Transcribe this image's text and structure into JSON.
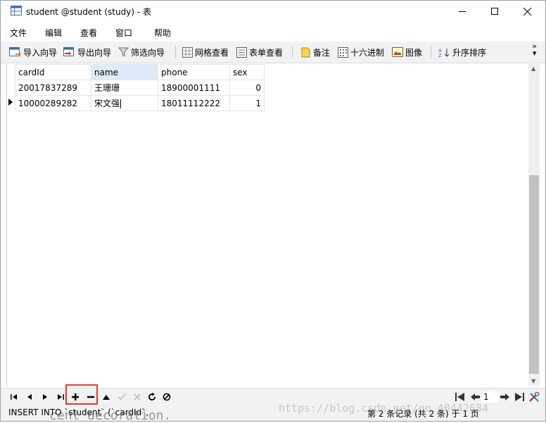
{
  "window": {
    "title": "student @student (study) - 表"
  },
  "menu": [
    "文件",
    "编辑",
    "查看",
    "窗口",
    "帮助"
  ],
  "toolbar": {
    "import_wizard": "导入向导",
    "export_wizard": "导出向导",
    "filter_wizard": "筛选向导",
    "grid_view": "网格查看",
    "form_view": "表单查看",
    "memo": "备注",
    "hex": "十六进制",
    "image": "图像",
    "sort_asc": "升序排序",
    "overflow": "»"
  },
  "grid": {
    "columns": [
      "cardId",
      "name",
      "phone",
      "sex"
    ],
    "selected_column": "name",
    "rows": [
      {
        "cardId": "20017837289",
        "name": "王珊珊",
        "phone": "18900001111",
        "sex": "0"
      },
      {
        "cardId": "10000289282",
        "name": "宋文强",
        "phone": "18011112222",
        "sex": "1"
      }
    ],
    "current_row": 2
  },
  "navigation": {
    "page": "1"
  },
  "status": {
    "sql": "INSERT INTO `student` (`cardId`,",
    "record_info": "第 2 条记录 (共 2 条) 于 1 页"
  },
  "watermark": "https://blog.csdn.net/qq_40442684",
  "bottom_text": "cent decoration."
}
